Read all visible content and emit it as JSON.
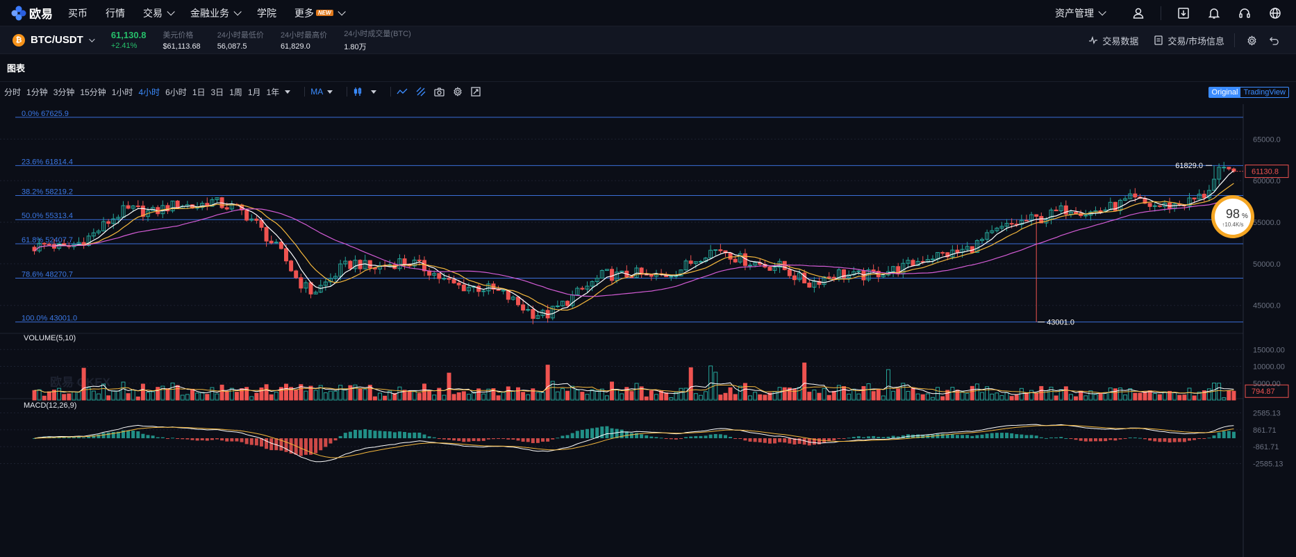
{
  "nav": {
    "logo_text": "欧易",
    "items": [
      "买币",
      "行情",
      "交易",
      "金融业务",
      "学院",
      "更多"
    ],
    "more_badge": "NEW",
    "asset_mgmt": "资产管理"
  },
  "ticker": {
    "pair": "BTC/USDT",
    "coin_glyph": "₿",
    "price": "61,130.8",
    "change": "+2.41%",
    "stats": [
      {
        "label": "美元价格",
        "value": "$61,113.68"
      },
      {
        "label": "24小时最低价",
        "value": "56,087.5"
      },
      {
        "label": "24小时最高价",
        "value": "61,829.0"
      },
      {
        "label": "24小时成交量(BTC)",
        "value": "1.80万"
      }
    ],
    "right": [
      "交易数据",
      "交易/市场信息"
    ]
  },
  "chart_header": {
    "title": "图表"
  },
  "toolbar": {
    "timeframes": [
      "分时",
      "1分钟",
      "3分钟",
      "15分钟",
      "1小时",
      "4小时",
      "6小时",
      "1日",
      "3日",
      "1周",
      "1月",
      "1年"
    ],
    "active_timeframe": "4小时",
    "indicator": "MA",
    "view_original": "Original",
    "view_tv": "TradingView"
  },
  "chart_data": {
    "type": "candlestick",
    "fib_levels": [
      {
        "label": "0.0% 67625.9",
        "value": 67625.9
      },
      {
        "label": "23.6% 61814.4",
        "value": 61814.4
      },
      {
        "label": "38.2% 58219.2",
        "value": 58219.2
      },
      {
        "label": "50.0% 55313.4",
        "value": 55313.4
      },
      {
        "label": "61.8% 52407.7",
        "value": 52407.7
      },
      {
        "label": "78.6% 48270.7",
        "value": 48270.7
      },
      {
        "label": "100.0% 43001.0",
        "value": 43001.0
      }
    ],
    "price_ticks": [
      "65000.0",
      "60000.0",
      "55000.0",
      "50000.0",
      "45000.0"
    ],
    "price_tick_values": [
      65000,
      60000,
      55000,
      50000,
      45000
    ],
    "y_range": [
      41800,
      69200
    ],
    "high_label": "61829.0",
    "low_label": "43001.0",
    "last_price_label": "61130.8",
    "last_price": 61130.8,
    "close_path": [
      52000,
      52400,
      51800,
      52500,
      53500,
      55000,
      56300,
      56500,
      56100,
      56800,
      57200,
      56800,
      57600,
      57000,
      56500,
      55200,
      53000,
      51000,
      48000,
      46500,
      47800,
      49500,
      50200,
      49400,
      49800,
      50300,
      50000,
      49200,
      48000,
      47300,
      47200,
      47000,
      46400,
      45200,
      44100,
      43800,
      45000,
      46300,
      47500,
      48800,
      48500,
      48900,
      48300,
      48600,
      49200,
      50300,
      51500,
      51800,
      50700,
      50200,
      49800,
      49700,
      48500,
      47600,
      48400,
      48900,
      48500,
      48600,
      49100,
      49300,
      50000,
      50800,
      51100,
      51300,
      51900,
      53000,
      54100,
      54800,
      55300,
      55500,
      56300,
      56800,
      56100,
      56500,
      57000,
      57800,
      57100,
      56900,
      57100,
      57500,
      58300,
      61000,
      61130.8
    ],
    "volume_label": "VOLUME(5,10)",
    "volume_ticks": [
      "15000.00",
      "10000.00",
      "5000.00"
    ],
    "volume_tick_values": [
      15000,
      10000,
      5000
    ],
    "volume_max": 16500,
    "volume_last": "794.87",
    "macd_label": "MACD(12,26,9)",
    "macd_ticks": [
      "2585.13",
      "861.71",
      "-861.71",
      "-2585.13"
    ],
    "macd_tick_values": [
      2585.13,
      861.71,
      -861.71,
      -2585.13
    ],
    "macd_range": [
      -2900,
      2900
    ],
    "watermark": "欧易 OKEX",
    "speed_percent": "98",
    "speed_rate": "↑10.4K/s"
  },
  "colors": {
    "up": "#26a69a",
    "down": "#ef5350",
    "bg": "#0b0e17",
    "fib": "#3b6fd8",
    "accent": "#3b8cff"
  }
}
